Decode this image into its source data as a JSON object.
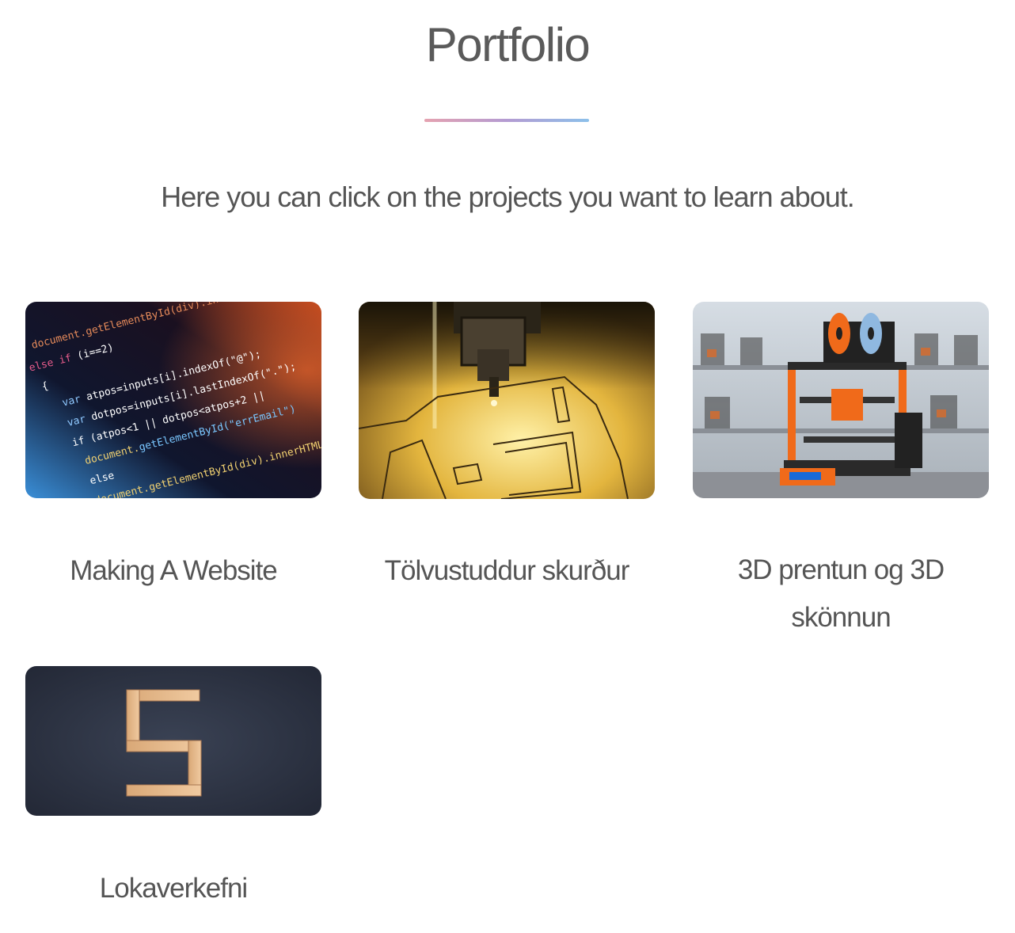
{
  "page": {
    "title": "Portfolio",
    "subtitle": "Here you can click on the projects you want to learn about."
  },
  "projects": [
    {
      "label": "Making A Website",
      "icon": "code-screenshot-image"
    },
    {
      "label": "Tölvustuddur skurður",
      "icon": "laser-cutter-image"
    },
    {
      "label": "3D prentun og 3D skönnun",
      "icon": "3d-printer-image"
    },
    {
      "label": "Lokaverkefni",
      "icon": "wooden-shelf-s-image"
    }
  ],
  "colors": {
    "divider_start": "#e5a2b0",
    "divider_end": "#8cc0ea",
    "text": "#555555"
  }
}
